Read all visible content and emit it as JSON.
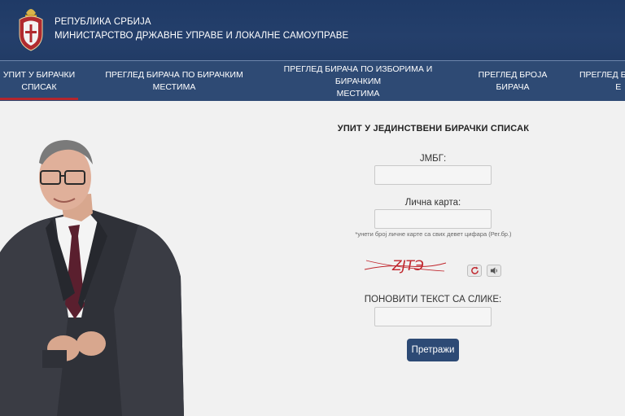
{
  "header": {
    "line1": "РЕПУБЛИКА СРБИЈА",
    "line2": "МИНИСТАРСТВО ДРЖАВНЕ УПРАВЕ И ЛОКАЛНЕ САМОУПРАВЕ",
    "crest_icon": "serbian-coat-of-arms-icon"
  },
  "nav": {
    "items": [
      {
        "line1": "УПИТ У БИРАЧКИ",
        "line2": "СПИСАК",
        "active": true
      },
      {
        "line1": "ПРЕГЛЕД БИРАЧА ПО БИРАЧКИМ",
        "line2": "МЕСТИМА"
      },
      {
        "line1": "ПРЕГЛЕД БИРАЧА ПО ИЗБОРИМА И БИРАЧКИМ",
        "line2": "МЕСТИМА"
      },
      {
        "line1": "ПРЕГЛЕД БРОЈА",
        "line2": "БИРАЧА"
      },
      {
        "line1": "ПРЕГЛЕД Б",
        "line2": "Е"
      }
    ],
    "active_color": "#b3262e"
  },
  "form": {
    "title": "УПИТ У ЈЕДИНСТВЕНИ БИРАЧКИ СПИСАК",
    "jmbg_label": "ЈМБГ:",
    "jmbg_value": "",
    "id_card_label": "Лична карта:",
    "id_card_value": "",
    "id_card_hint": "*унети број личне карте са свих девет цифара (Рег.бр.)",
    "captcha_text": "ZJTЭ",
    "refresh_icon": "refresh-icon",
    "audio_icon": "speaker-icon",
    "repeat_label": "ПОНОВИТИ ТЕКСТ СА СЛИКЕ:",
    "repeat_value": "",
    "submit_label": "Претражи"
  },
  "colors": {
    "header_bg": "#223c66",
    "nav_bg": "#2e4a74",
    "button_bg": "#2d4a75",
    "captcha_red": "#c0262d"
  }
}
